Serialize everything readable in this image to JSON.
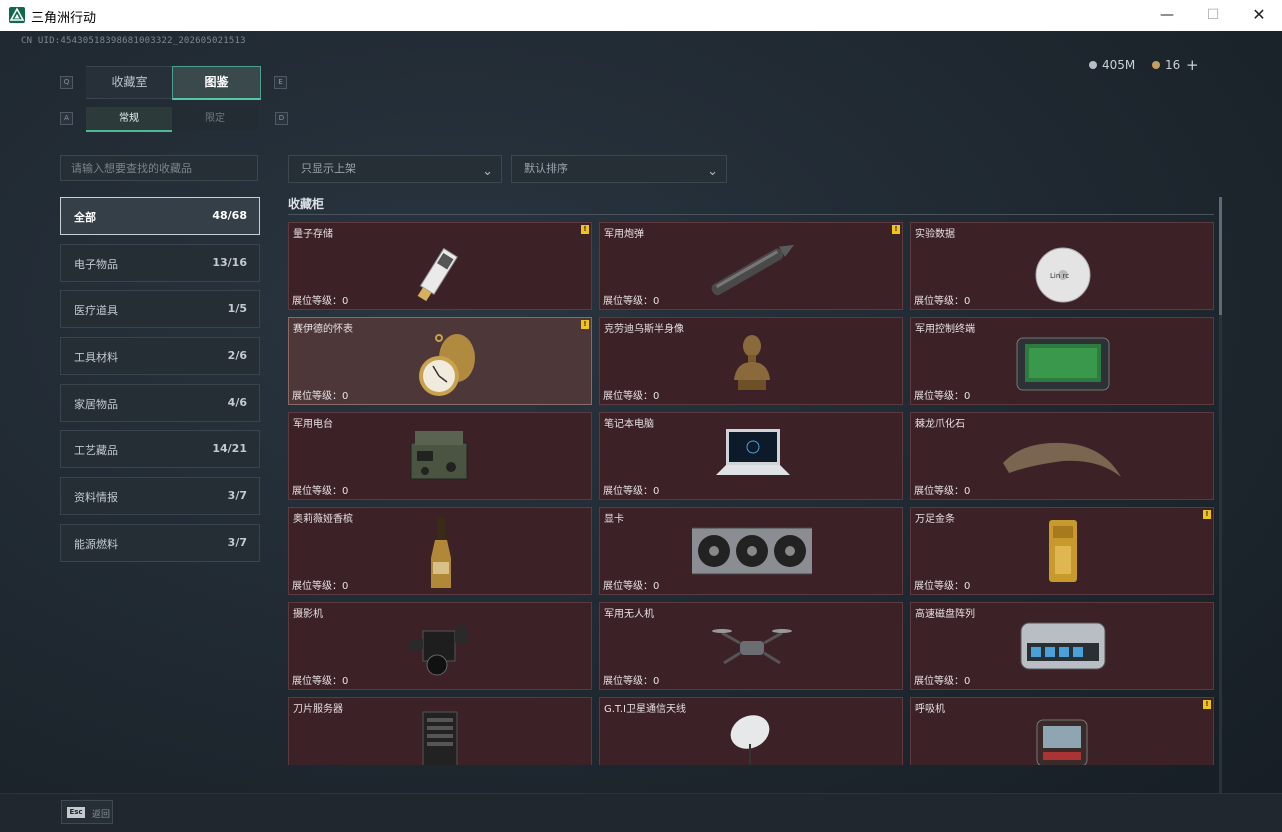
{
  "window": {
    "title": "三角洲行动",
    "minimize": "—",
    "maximize": "☐",
    "close": "✕"
  },
  "header": {
    "uid": "CN UID:4543051839868100332​2_202605021513",
    "currency1": "405M",
    "currency2": "16",
    "plus": "+"
  },
  "tabs": [
    {
      "label": "收藏室",
      "key": "Q"
    },
    {
      "label": "图鉴",
      "key": "E"
    }
  ],
  "subtabs": [
    {
      "label": "常规",
      "key": "A"
    },
    {
      "label": "限定",
      "key": "D"
    }
  ],
  "search": {
    "placeholder": "请输入想要查找的收藏品"
  },
  "filters": {
    "shelf": "只显示上架",
    "sort": "默认排序"
  },
  "categories": [
    {
      "name": "全部",
      "count": "48/68"
    },
    {
      "name": "电子物品",
      "count": "13/16"
    },
    {
      "name": "医疗道具",
      "count": "1/5"
    },
    {
      "name": "工具材料",
      "count": "2/6"
    },
    {
      "name": "家居物品",
      "count": "4/6"
    },
    {
      "name": "工艺藏品",
      "count": "14/21"
    },
    {
      "name": "资料情报",
      "count": "3/7"
    },
    {
      "name": "能源燃料",
      "count": "3/7"
    }
  ],
  "section": {
    "title": "收藏柜"
  },
  "items": [
    {
      "name": "量子存储",
      "level": "展位等级：0",
      "warn": true,
      "icon": "usb-drive-icon"
    },
    {
      "name": "军用炮弹",
      "level": "展位等级：0",
      "warn": true,
      "icon": "artillery-shell-icon"
    },
    {
      "name": "实验数据",
      "level": "展位等级：0",
      "warn": false,
      "icon": "disc-icon"
    },
    {
      "name": "赛伊德的怀表",
      "level": "展位等级：0",
      "warn": true,
      "icon": "pocket-watch-icon"
    },
    {
      "name": "克劳迪乌斯半身像",
      "level": "展位等级：0",
      "warn": false,
      "icon": "bust-statue-icon"
    },
    {
      "name": "军用控制终端",
      "level": "展位等级：0",
      "warn": false,
      "icon": "control-terminal-icon"
    },
    {
      "name": "军用电台",
      "level": "展位等级：0",
      "warn": false,
      "icon": "radio-icon"
    },
    {
      "name": "笔记本电脑",
      "level": "展位等级：0",
      "warn": false,
      "icon": "laptop-icon"
    },
    {
      "name": "棘龙爪化石",
      "level": "展位等级：0",
      "warn": false,
      "icon": "claw-fossil-icon"
    },
    {
      "name": "奥莉薇娅香槟",
      "level": "展位等级：0",
      "warn": false,
      "icon": "champagne-bottle-icon"
    },
    {
      "name": "显卡",
      "level": "展位等级：0",
      "warn": false,
      "icon": "graphics-card-icon"
    },
    {
      "name": "万足金条",
      "level": "展位等级：0",
      "warn": true,
      "icon": "gold-bar-icon"
    },
    {
      "name": "摄影机",
      "level": "展位等级：0",
      "warn": false,
      "icon": "camera-icon"
    },
    {
      "name": "军用无人机",
      "level": "展位等级：0",
      "warn": false,
      "icon": "drone-icon"
    },
    {
      "name": "高速磁盘阵列",
      "level": "展位等级：0",
      "warn": false,
      "icon": "disk-array-icon"
    },
    {
      "name": "刀片服务器",
      "level": "",
      "warn": false,
      "icon": "blade-server-icon"
    },
    {
      "name": "G.T.I卫星通信天线",
      "level": "",
      "warn": false,
      "icon": "satellite-dish-icon"
    },
    {
      "name": "呼吸机",
      "level": "",
      "warn": true,
      "icon": "ventilator-icon"
    }
  ],
  "footer": {
    "esc_key": "Esc",
    "esc_label": "返回"
  },
  "colors": {
    "accent": "#53c7a6",
    "card_bg": "#3c2126",
    "warn": "#f0c419"
  }
}
